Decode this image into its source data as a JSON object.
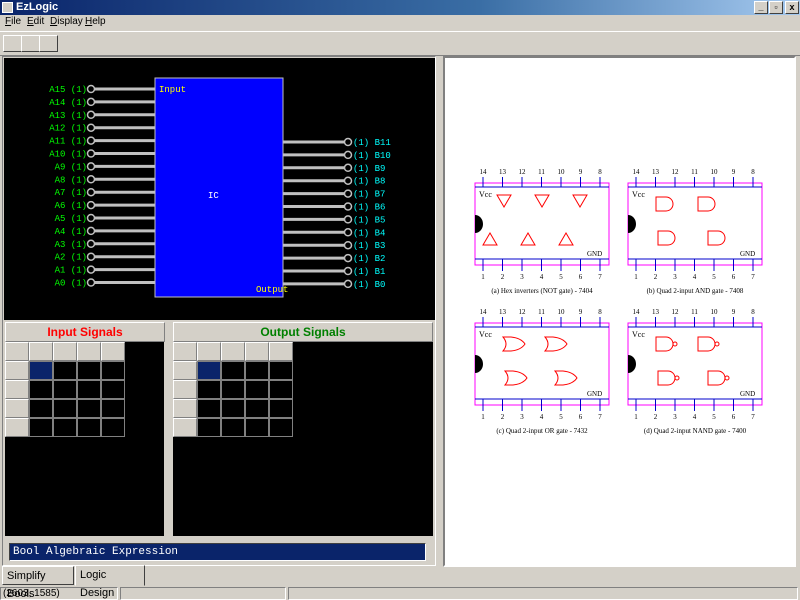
{
  "window": {
    "title": "EzLogic",
    "minimize": "_",
    "restore": "▫",
    "close": "x"
  },
  "menu": [
    {
      "acc": "F",
      "rest": "ile"
    },
    {
      "acc": "E",
      "rest": "dit"
    },
    {
      "acc": "D",
      "rest": "isplay"
    },
    {
      "acc": "H",
      "rest": "elp"
    }
  ],
  "circuit": {
    "ic_label": "IC",
    "input_label": "Input",
    "output_label": "Output",
    "inputs": [
      "A15",
      "A14",
      "A13",
      "A12",
      "A11",
      "A10",
      "A9",
      "A8",
      "A7",
      "A6",
      "A5",
      "A4",
      "A3",
      "A2",
      "A1",
      "A0"
    ],
    "input_values": [
      "(1)",
      "(1)",
      "(1)",
      "(1)",
      "(1)",
      "(1)",
      "(1)",
      "(1)",
      "(1)",
      "(1)",
      "(1)",
      "(1)",
      "(1)",
      "(1)",
      "(1)",
      "(1)"
    ],
    "outputs": [
      "B11",
      "B10",
      "B9",
      "B8",
      "B7",
      "B6",
      "B5",
      "B4",
      "B3",
      "B2",
      "B1",
      "B0"
    ],
    "output_values": [
      "(1)",
      "(1)",
      "(1)",
      "(1)",
      "(1)",
      "(1)",
      "(1)",
      "(1)",
      "(1)",
      "(1)",
      "(1)",
      "(1)"
    ],
    "colors": {
      "ic": "#0000ff",
      "input_text": "#00ff00",
      "output_text": "#00ffff",
      "pin": "#c0c0c0"
    }
  },
  "input_signals": {
    "title": "Input Signals",
    "color": "#ff0000"
  },
  "output_signals": {
    "title": "Output Signals",
    "color": "#008000"
  },
  "expression": {
    "value": "Bool Algebraic Expression"
  },
  "tabs": [
    {
      "label": "Simplify Bools",
      "active": false
    },
    {
      "label": "Logic Design",
      "active": true
    }
  ],
  "status": {
    "coords": "(2603, 1585)"
  },
  "reference": {
    "chips": [
      {
        "caption": "(a) Hex inverters (NOT gate) - 7404",
        "top_pins": [
          "14",
          "13",
          "12",
          "11",
          "10",
          "9",
          "8"
        ],
        "bottom_pins": [
          "1",
          "2",
          "3",
          "4",
          "5",
          "6",
          "7"
        ],
        "vcc": "Vcc",
        "gnd": "GND",
        "gate": "not"
      },
      {
        "caption": "(b) Quad 2-input AND gate - 7408",
        "top_pins": [
          "14",
          "13",
          "12",
          "11",
          "10",
          "9",
          "8"
        ],
        "bottom_pins": [
          "1",
          "2",
          "3",
          "4",
          "5",
          "6",
          "7"
        ],
        "vcc": "Vcc",
        "gnd": "GND",
        "gate": "and"
      },
      {
        "caption": "(c) Quad 2-input OR gate - 7432",
        "top_pins": [
          "14",
          "13",
          "12",
          "11",
          "10",
          "9",
          "8"
        ],
        "bottom_pins": [
          "1",
          "2",
          "3",
          "4",
          "5",
          "6",
          "7"
        ],
        "vcc": "Vcc",
        "gnd": "GND",
        "gate": "or"
      },
      {
        "caption": "(d) Quad 2-input NAND gate - 7400",
        "top_pins": [
          "14",
          "13",
          "12",
          "11",
          "10",
          "9",
          "8"
        ],
        "bottom_pins": [
          "1",
          "2",
          "3",
          "4",
          "5",
          "6",
          "7"
        ],
        "vcc": "Vcc",
        "gnd": "GND",
        "gate": "nand"
      }
    ]
  }
}
